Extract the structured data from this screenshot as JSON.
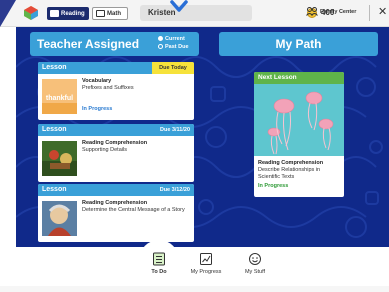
{
  "topbar": {
    "subjects": [
      {
        "label": "Reading",
        "active": true
      },
      {
        "label": "Math",
        "active": false
      }
    ],
    "student_name": "Kristen",
    "coins": "400",
    "family_center_label": "Family Center",
    "close_icon": "close-icon",
    "colors": {
      "brand_dark": "#1c2b6e",
      "coin": "#f1c232"
    }
  },
  "teacher_assigned": {
    "title": "Teacher Assigned",
    "filters": [
      {
        "label": "Current",
        "selected": true
      },
      {
        "label": "Past Due",
        "selected": false
      }
    ],
    "cards": [
      {
        "type": "Lesson",
        "due": "Due Today",
        "title": "Vocabulary",
        "subtitle": "Prefixes and Suffixes",
        "status": "In Progress",
        "thumb_word": "thankful"
      },
      {
        "type": "Lesson",
        "due": "Due 3/11/20",
        "title": "Reading Comprehension",
        "subtitle": "Supporting Details",
        "status": ""
      },
      {
        "type": "Lesson",
        "due": "Due 3/12/20",
        "title": "Reading Comprehension",
        "subtitle": "Determine the Central Message of a Story",
        "status": ""
      }
    ]
  },
  "my_path": {
    "title": "My Path",
    "next_lesson": {
      "header": "Next Lesson",
      "title": "Reading Comprehension",
      "subtitle": "Describe Relationships in Scientific Texts",
      "status": "In Progress"
    }
  },
  "bottom_nav": [
    {
      "label": "To Do",
      "icon": "todo-list-icon",
      "active": true
    },
    {
      "label": "My Progress",
      "icon": "progress-chart-icon",
      "active": false
    },
    {
      "label": "My Stuff",
      "icon": "smiley-icon",
      "active": false
    }
  ],
  "colors": {
    "main_bg": "#10298a",
    "header_blue": "#3aa0d8",
    "due_today": "#f6e23a",
    "next_lesson_green": "#5fb44a",
    "in_progress_blue": "#2a7bd1",
    "in_progress_green": "#2e9a36"
  }
}
